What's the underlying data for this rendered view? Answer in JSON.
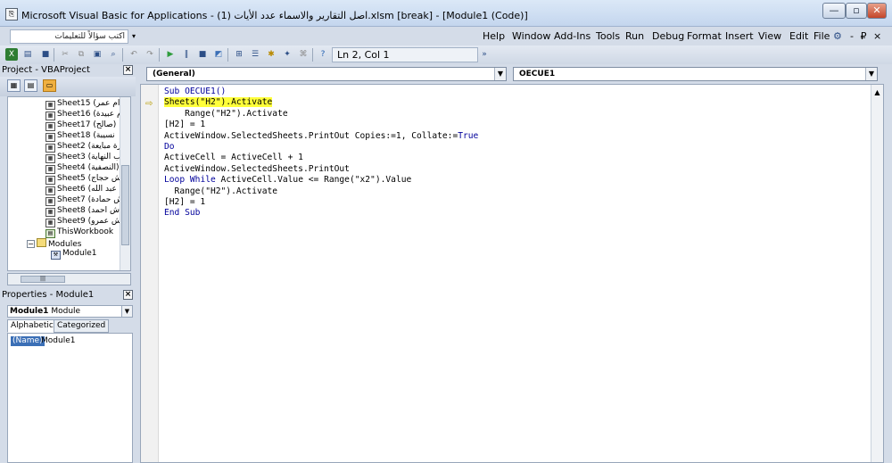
{
  "titlebar": {
    "title": "Microsoft Visual Basic for Applications - (اصل التقارير  والاسماء عدد الأيات (1.xlsm [break] - [Module1 (Code)]",
    "minimize": "—",
    "restore": "▫",
    "close": "✕"
  },
  "menubar": {
    "ask_placeholder": "اكتب سؤالاً للتعليمات",
    "items": [
      "Help",
      "Window",
      "Add-Ins",
      "Tools",
      "Run",
      "Debug",
      "Format",
      "Insert",
      "View",
      "Edit",
      "File"
    ],
    "right_controls": "- ₽ ×"
  },
  "toolbar": {
    "position_text": "Ln 2, Col 1"
  },
  "project_explorer": {
    "title": "Project - VBAProject",
    "sheets": [
      "Sheet15 (ام عمر",
      "Sheet16 (م عبيدة",
      "Sheet17 (صالح)",
      "Sheet18 (نسيبة",
      "Sheet2 (ارة مبايعة",
      "Sheet3 (ب النهاية",
      "Sheet4 (النصفية)",
      "Sheet5 (ش حجاج",
      "Sheet6 (ش عبد الله",
      "Sheet7 (ش حمادة",
      "Sheet8 (ش احمد",
      "Sheet9 (ش عمرو"
    ],
    "workbook": "ThisWorkbook",
    "modules_folder": "Modules",
    "module_item": "Module1"
  },
  "properties": {
    "title": "Properties - Module1",
    "object_name": "Module1",
    "object_type": "Module",
    "tab_alpha": "Alphabetic",
    "tab_cat": "Categorized",
    "prop_name": "(Name)",
    "prop_value": "Module1"
  },
  "code_window": {
    "object_combo": "(General)",
    "proc_combo": "OECUE1",
    "lines": [
      "Sub OECUE1()",
      "Sheets(\"H2\").Activate",
      "    Range(\"H2\").Activate",
      "[H2] = 1",
      "ActiveWindow.SelectedSheets.PrintOut Copies:=1, Collate:=True",
      "Do",
      "ActiveCell = ActiveCell + 1",
      "ActiveWindow.SelectedSheets.PrintOut",
      "Loop While ActiveCell.Value <= Range(\"x2\").Value",
      "  Range(\"H2\").Activate",
      "[H2] = 1",
      "End Sub"
    ]
  }
}
